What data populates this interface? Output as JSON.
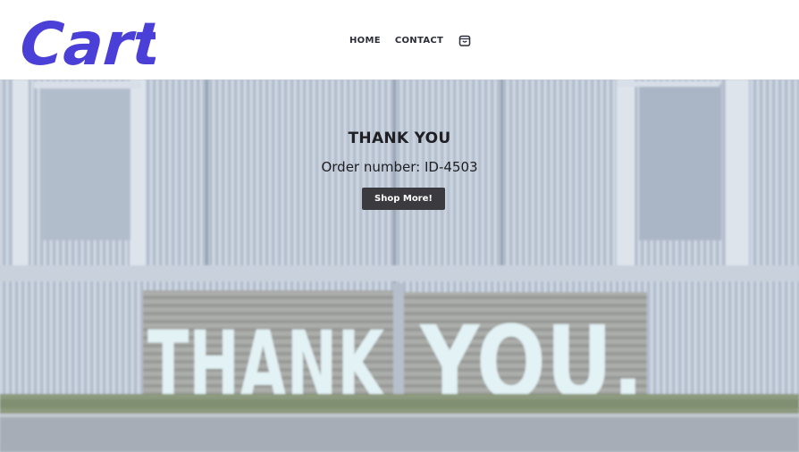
{
  "header": {
    "logo_text": "Cart",
    "nav": [
      {
        "label": "HOME"
      },
      {
        "label": "CONTACT"
      }
    ],
    "cart_icon": "shopping-bag-icon"
  },
  "hero": {
    "title": "THANK YOU",
    "order_line": "Order number: ID-4503",
    "button_label": "Shop More!",
    "sign_text": "THANK YOU.",
    "colors": {
      "logo": "#4a3fd6",
      "button_bg": "#3b3b3f",
      "text": "#202024",
      "sign_letters": "#e2f2f5"
    }
  }
}
